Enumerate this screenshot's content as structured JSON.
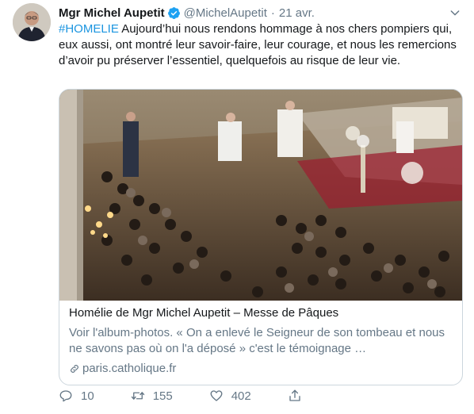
{
  "author": {
    "name": "Mgr Michel Aupetit",
    "handle": "@MichelAupetit",
    "separator": "·",
    "time": "21 avr."
  },
  "tweet": {
    "hashtag": "#HOMELIE",
    "text": " Aujourd’hui nous rendons hommage à nos chers pompiers qui, eux aussi, ont montré leur savoir-faire, leur courage, et nous les remercions  d’avoir pu préserver l’essentiel, quelquefois au risque de leur vie."
  },
  "card": {
    "title": "Homélie de Mgr Michel Aupetit – Messe de Pâques",
    "description": "Voir l'album-photos. « On a enlevé le Seigneur de son tombeau et nous ne savons pas où on l'a déposé » c'est le témoignage …",
    "domain": "paris.catholique.fr"
  },
  "actions": {
    "replies": "10",
    "retweets": "155",
    "likes": "402"
  },
  "colors": {
    "link": "#1b95e0",
    "verified": "#1da1f2",
    "secondary_text": "#657786",
    "border": "#ccd6dd"
  },
  "icons": [
    "verified-badge-icon",
    "chevron-down-icon",
    "link-icon",
    "reply-icon",
    "retweet-icon",
    "like-icon",
    "share-icon"
  ]
}
